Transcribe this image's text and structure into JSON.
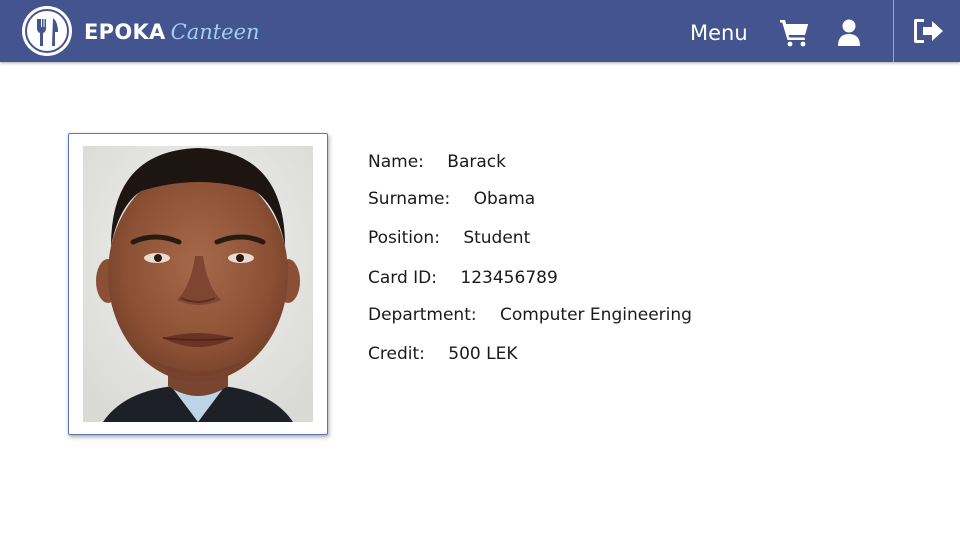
{
  "header": {
    "brand_main": "EPOKA",
    "brand_sub": "Canteen",
    "menu_label": "Menu",
    "icons": {
      "logo": "fork-knife-logo-icon",
      "cart": "shopping-cart-icon",
      "user": "user-profile-icon",
      "logout": "logout-icon"
    }
  },
  "profile": {
    "photo_alt": "Profile photo",
    "fields": [
      {
        "label": "Name:",
        "value": "Barack"
      },
      {
        "label": "Surname:",
        "value": "Obama"
      },
      {
        "label": "Position:",
        "value": "Student"
      },
      {
        "label": "Card ID:",
        "value": "123456789"
      },
      {
        "label": "Department:",
        "value": "Computer Engineering"
      },
      {
        "label": "Credit:",
        "value": "500 LEK"
      }
    ]
  },
  "colors": {
    "header_bg": "#43548f",
    "brand_accent": "#9ed0f4",
    "frame_border": "#5a78b7"
  }
}
